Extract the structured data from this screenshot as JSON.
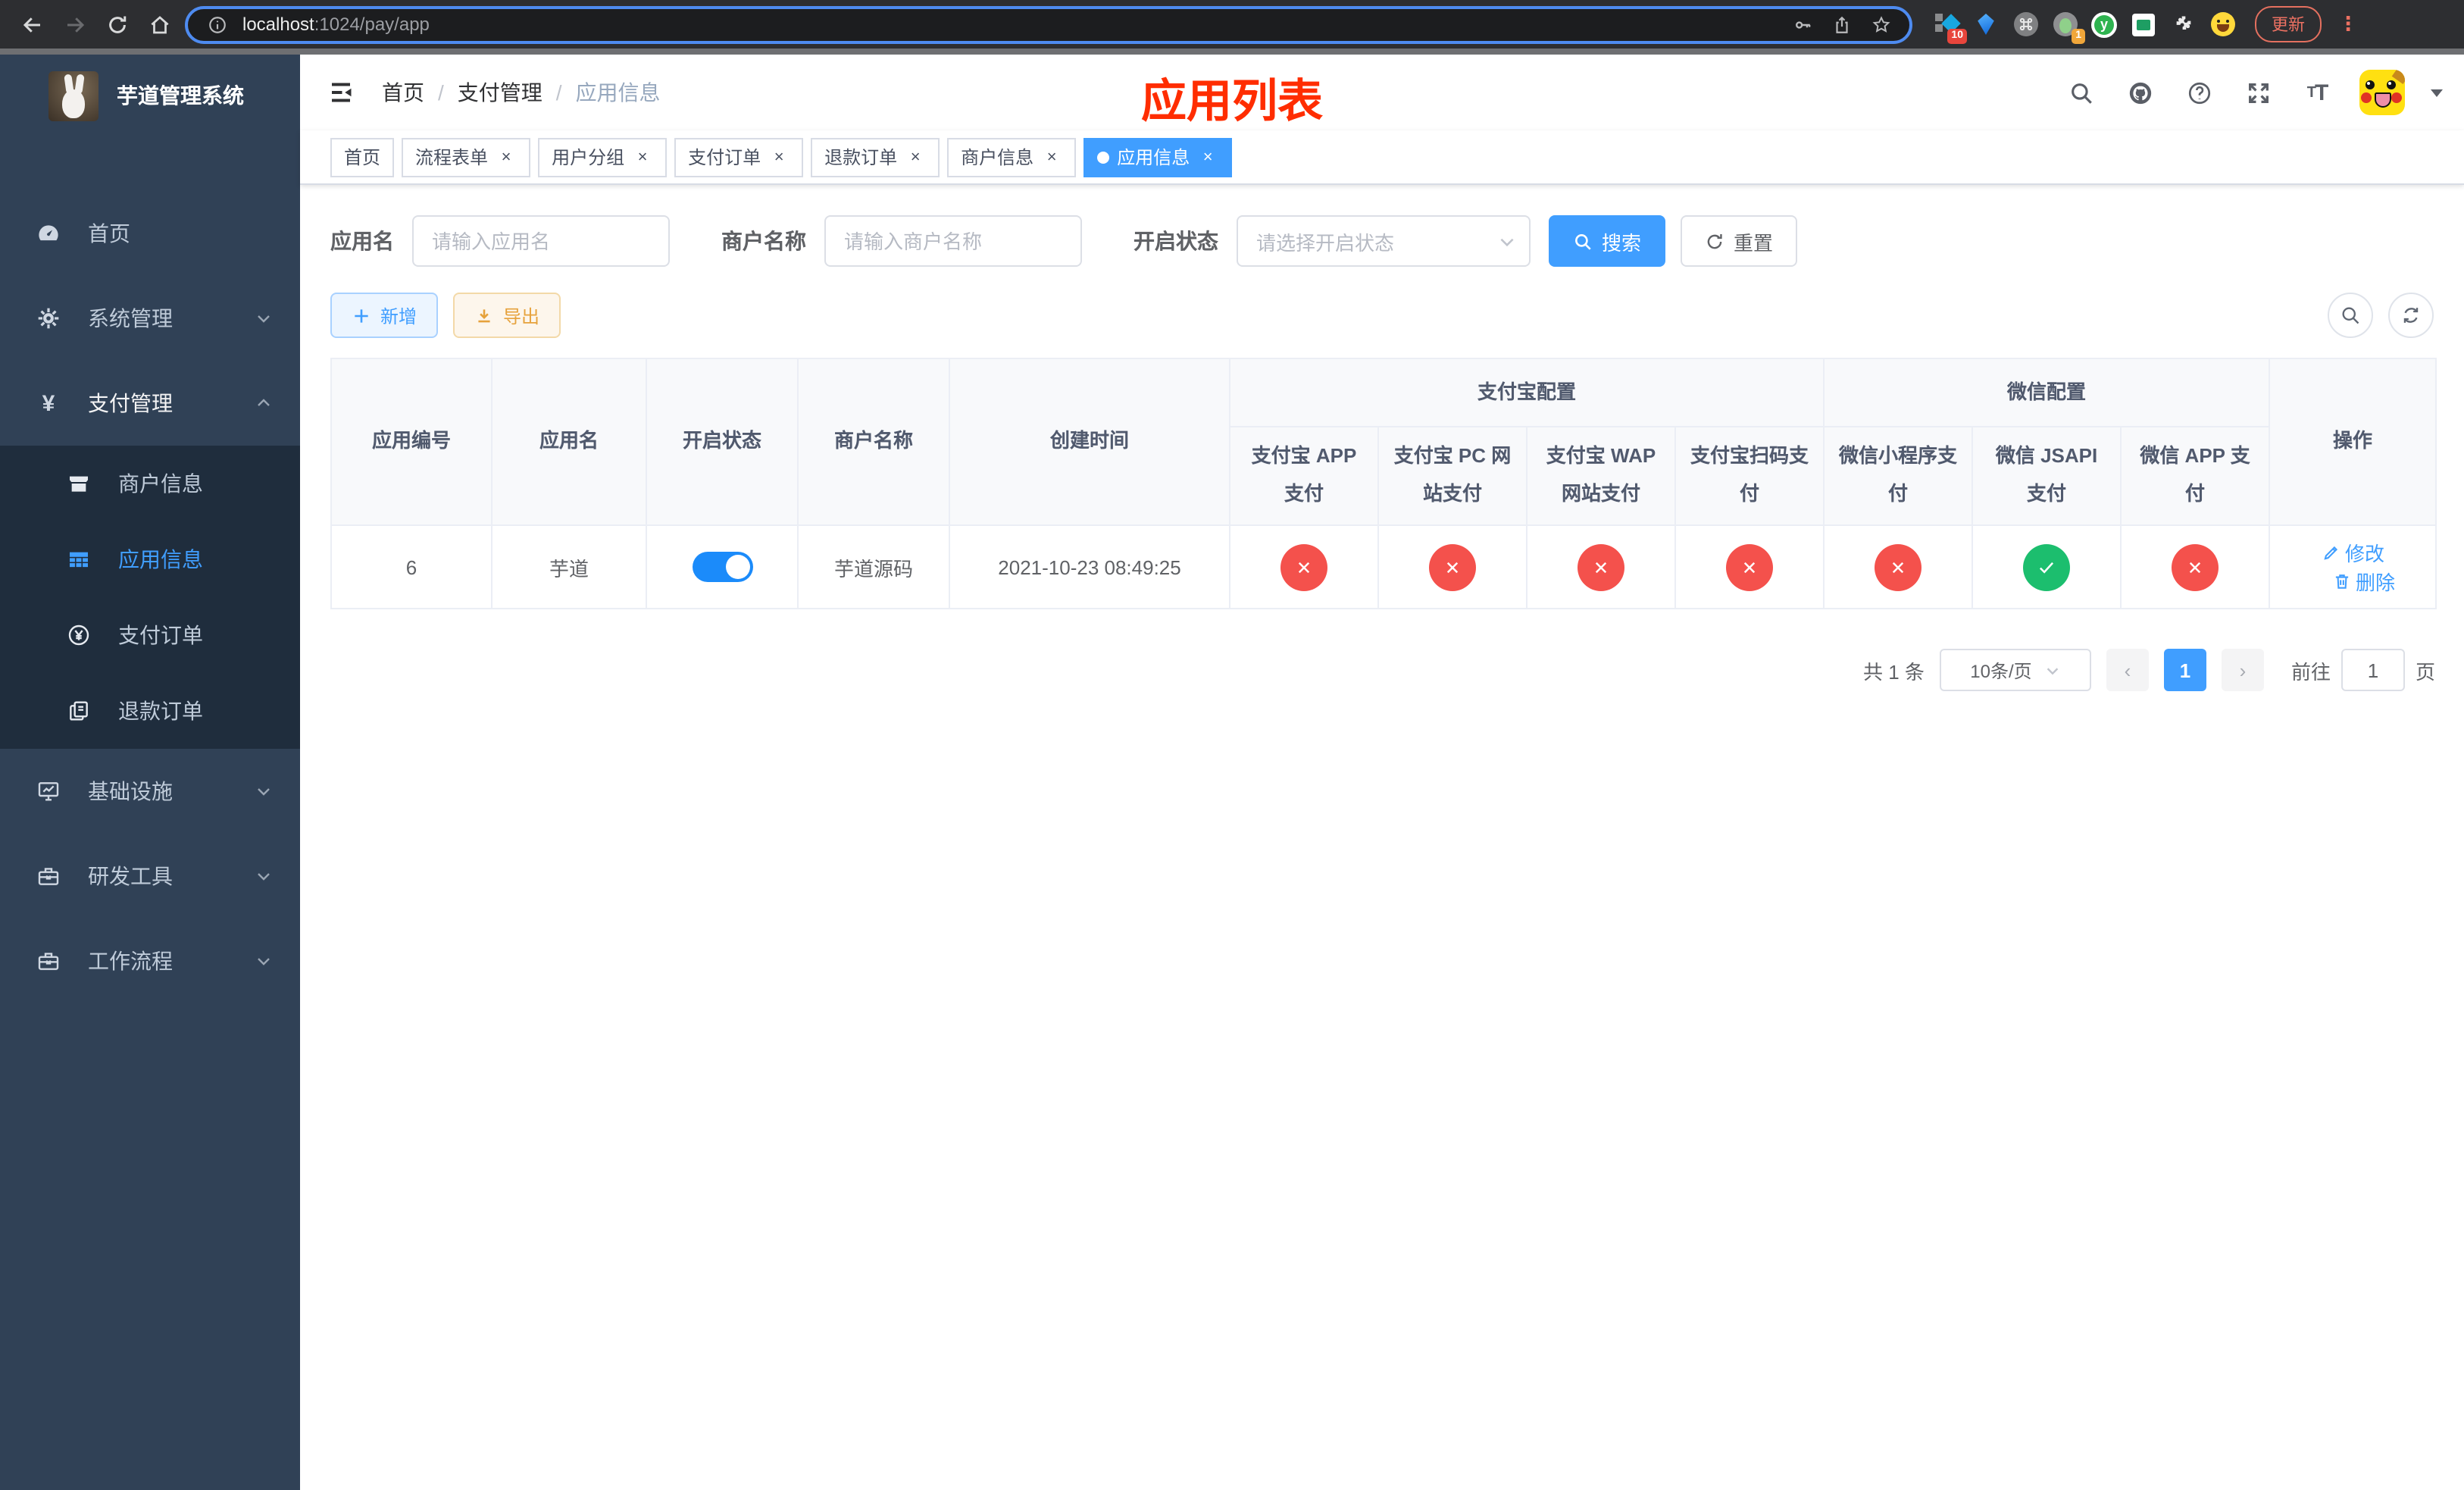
{
  "browser": {
    "url_host": "localhost",
    "url_rest": ":1024/pay/app",
    "update_button": "更新",
    "kebab": "⋮",
    "ext_badge_blue_diamond": "10",
    "ext_badge_profile": "1",
    "ext_y_letter": "y"
  },
  "sidebar": {
    "title": "芋道管理系统",
    "menu": [
      {
        "label": "首页"
      },
      {
        "label": "系统管理"
      },
      {
        "label": "支付管理"
      },
      {
        "label": "基础设施"
      },
      {
        "label": "研发工具"
      },
      {
        "label": "工作流程"
      }
    ],
    "submenu": [
      {
        "label": "商户信息"
      },
      {
        "label": "应用信息"
      },
      {
        "label": "支付订单"
      },
      {
        "label": "退款订单"
      }
    ]
  },
  "navbar": {
    "breadcrumb": [
      "首页",
      "支付管理",
      "应用信息"
    ],
    "overlay_title": "应用列表"
  },
  "tabs": [
    {
      "label": "首页"
    },
    {
      "label": "流程表单"
    },
    {
      "label": "用户分组"
    },
    {
      "label": "支付订单"
    },
    {
      "label": "退款订单"
    },
    {
      "label": "商户信息"
    },
    {
      "label": "应用信息"
    }
  ],
  "filters": {
    "app_name_label": "应用名",
    "app_name_placeholder": "请输入应用名",
    "merchant_label": "商户名称",
    "merchant_placeholder": "请输入商户名称",
    "status_label": "开启状态",
    "status_placeholder": "请选择开启状态",
    "search_button": "搜索",
    "reset_button": "重置"
  },
  "toolbar": {
    "add_button": "新增",
    "export_button": "导出"
  },
  "table": {
    "group_alipay": "支付宝配置",
    "group_wechat": "微信配置",
    "col_app_id": "应用编号",
    "col_app_name": "应用名",
    "col_status": "开启状态",
    "col_merchant": "商户名称",
    "col_created": "创建时间",
    "col_alipay_app": "支付宝 APP 支付",
    "col_alipay_pc": "支付宝 PC 网站支付",
    "col_alipay_wap": "支付宝 WAP 网站支付",
    "col_alipay_qr": "支付宝扫码支付",
    "col_wx_mini": "微信小程序支付",
    "col_wx_jsapi": "微信 JSAPI 支付",
    "col_wx_app": "微信 APP 支付",
    "col_actions": "操作",
    "row": {
      "app_id": "6",
      "app_name": "芋道",
      "enabled": true,
      "merchant": "芋道源码",
      "created": "2021-10-23 08:49:25",
      "statuses": [
        "fail",
        "fail",
        "fail",
        "fail",
        "fail",
        "ok",
        "fail"
      ],
      "edit": "修改",
      "delete": "删除"
    }
  },
  "pagination": {
    "total": "共 1 条",
    "page_size": "10条/页",
    "page": "1",
    "goto_label": "前往",
    "goto_value": "1",
    "goto_suffix": "页"
  },
  "colors": {
    "primary": "#409eff",
    "success": "#1cbe6e",
    "danger": "#f4514c",
    "warning": "#e6a23c",
    "banner_red": "#ff2d00",
    "sidebar_bg": "#304156",
    "submenu_bg": "#1f2d3d"
  }
}
